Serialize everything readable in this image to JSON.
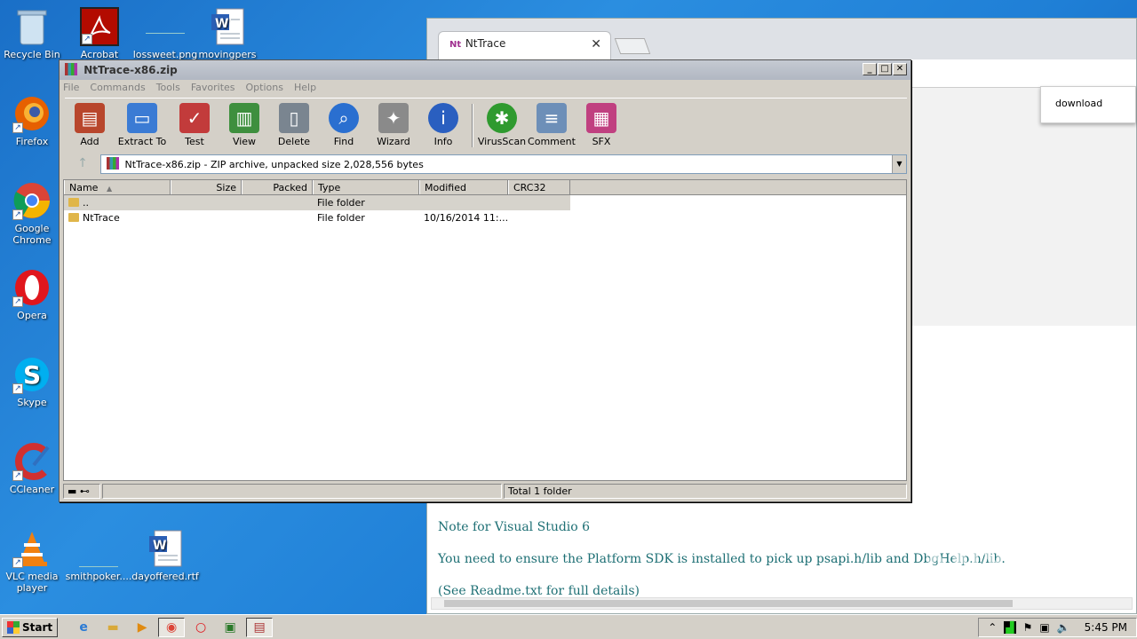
{
  "desktop": {
    "icons": [
      {
        "label": "Recycle Bin",
        "icon": "recycle-bin-icon"
      },
      {
        "label": "Acrobat",
        "icon": "acrobat-icon"
      },
      {
        "label": "lossweet.png",
        "icon": "image-file-icon"
      },
      {
        "label": "movingpers",
        "icon": "word-doc-icon"
      },
      {
        "label": "Firefox",
        "icon": "firefox-icon"
      },
      {
        "label": "Google Chrome",
        "icon": "chrome-icon"
      },
      {
        "label": "Opera",
        "icon": "opera-icon"
      },
      {
        "label": "Skype",
        "icon": "skype-icon"
      },
      {
        "label": "CCleaner",
        "icon": "ccleaner-icon"
      },
      {
        "label": "VLC media player",
        "icon": "vlc-icon"
      },
      {
        "label": "smithpoker....",
        "icon": "file-icon"
      },
      {
        "label": "dayoffered.rtf",
        "icon": "word-doc-icon"
      }
    ]
  },
  "chrome": {
    "tab_title": "NtTrace",
    "tab_favicon": "Nt",
    "download_popup": "download",
    "doc_lines": [
      "Note for Visual Studio 6",
      "You need to ensure the Platform SDK is installed to pick up psapi.h/lib and DbgHelp.h/lib.",
      "(See Readme.txt for full details)"
    ]
  },
  "winrar": {
    "title": "NtTrace-x86.zip",
    "menu": [
      "File",
      "Commands",
      "Tools",
      "Favorites",
      "Options",
      "Help"
    ],
    "toolbar": [
      {
        "label": "Add",
        "icon": "add-archive-icon",
        "color": "#b8462c"
      },
      {
        "label": "Extract To",
        "icon": "extract-folder-icon",
        "color": "#3b7bd4"
      },
      {
        "label": "Test",
        "icon": "test-clipboard-icon",
        "color": "#c23b3b"
      },
      {
        "label": "View",
        "icon": "view-book-icon",
        "color": "#3e8f3e"
      },
      {
        "label": "Delete",
        "icon": "delete-trash-icon",
        "color": "#7a8590"
      },
      {
        "label": "Find",
        "icon": "find-magnifier-icon",
        "color": "#2a6fd0"
      },
      {
        "label": "Wizard",
        "icon": "wizard-wand-icon",
        "color": "#8a8a8a"
      },
      {
        "label": "Info",
        "icon": "info-icon",
        "color": "#2a5fc0"
      },
      {
        "label": "VirusScan",
        "icon": "virus-scan-icon",
        "color": "#2f9a2f"
      },
      {
        "label": "Comment",
        "icon": "comment-icon",
        "color": "#6d8fb8"
      },
      {
        "label": "SFX",
        "icon": "sfx-icon",
        "color": "#c04080"
      }
    ],
    "address": "NtTrace-x86.zip - ZIP archive, unpacked size 2,028,556 bytes",
    "columns": [
      "Name",
      "Size",
      "Packed",
      "Type",
      "Modified",
      "CRC32"
    ],
    "rows": [
      {
        "name": "..",
        "size": "",
        "packed": "",
        "type": "File folder",
        "modified": "",
        "crc": ""
      },
      {
        "name": "NtTrace",
        "size": "",
        "packed": "",
        "type": "File folder",
        "modified": "10/16/2014 11:...",
        "crc": ""
      }
    ],
    "status": "Total 1 folder"
  },
  "taskbar": {
    "start_label": "Start",
    "clock": "5:45 PM"
  },
  "watermark": "ANY RUN"
}
